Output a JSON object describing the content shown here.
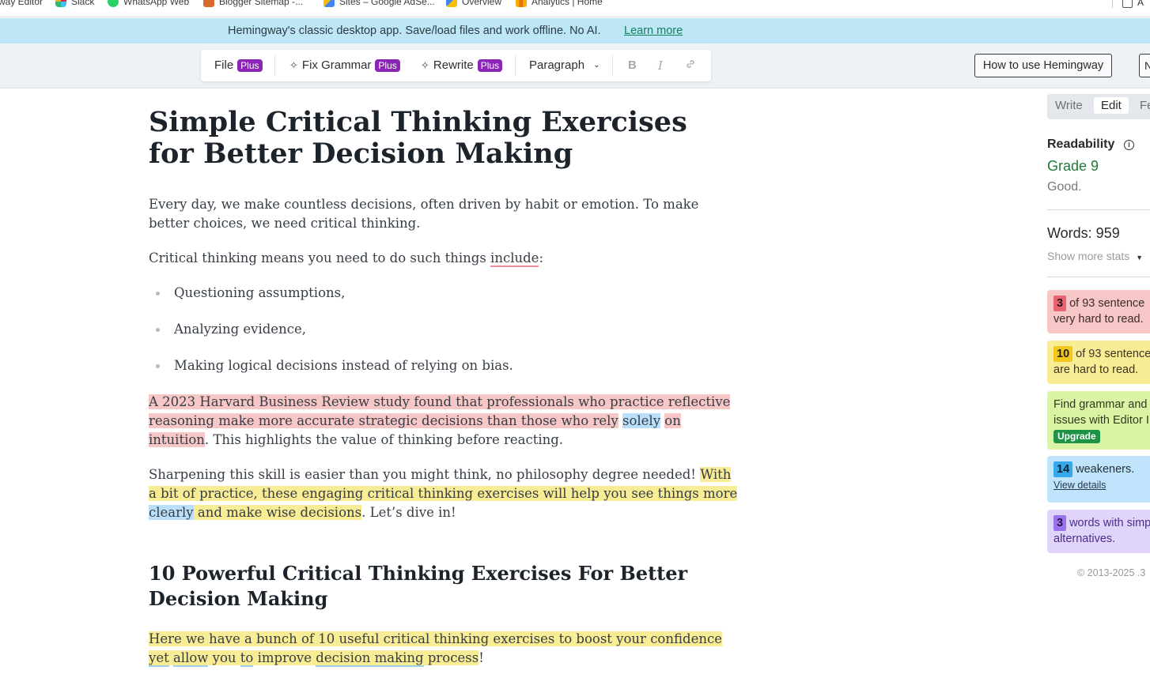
{
  "bookmarks": [
    {
      "label": "way Editor",
      "icon": "page-icon"
    },
    {
      "label": "Slack",
      "icon": "slack-icon"
    },
    {
      "label": "WhatsApp Web",
      "icon": "whatsapp-icon"
    },
    {
      "label": "Blogger Sitemap -...",
      "icon": "sitemap-icon"
    },
    {
      "label": "Sites – Google AdSe...",
      "icon": "adsense-icon"
    },
    {
      "label": "Overview",
      "icon": "overview-icon"
    },
    {
      "label": "Analytics | Home",
      "icon": "analytics-icon"
    }
  ],
  "bookmarks_right": "A",
  "banner": {
    "text": "Hemingway's classic desktop app. Save/load files and work offline. No AI.",
    "link": "Learn more"
  },
  "toolbar": {
    "file": "File",
    "fix_grammar": "Fix Grammar",
    "rewrite": "Rewrite",
    "plus": "Plus",
    "paragraph": "Paragraph",
    "bold": "B",
    "italic": "I",
    "how_to": "How to use Hemingway",
    "edge_button": "N"
  },
  "document": {
    "title": "Simple Critical Thinking Exercises for Better Decision Making",
    "p1": "Every day, we make countless decisions, often driven by habit or emotion. To make better choices, we need critical thinking.",
    "p2_a": "Critical thinking means you need to do such things ",
    "p2_include": "include",
    "p2_b": ":",
    "bullets": [
      "Questioning assumptions,",
      "Analyzing evidence,",
      "Making logical decisions instead of relying on bias."
    ],
    "p3_red_a": "A 2023 Harvard Business Review study found that professionals who practice reflective reasoning make more accurate strategic decisions than those who rely",
    "p3_space": " ",
    "p3_solely": "solely",
    "p3_red_b": "on intuition",
    "p3_rest": ". This highlights the value of thinking before reacting.",
    "p4_a": "Sharpening this skill is easier than you might think, no philosophy degree needed! ",
    "p4_yel_a": "With a bit of practice, these engaging critical thinking exercises will help you see things more",
    "p4_clearly": "clearly",
    "p4_yel_b": " and make wise decisions",
    "p4_rest": ". Let’s dive in!",
    "h2": "10 Powerful Critical Thinking Exercises For Better Decision Making",
    "p5_a": "Here we have a bunch of 10 useful critical thinking exercises to boost your confidence ",
    "p5_yet": "yet",
    "p5_sp1": " ",
    "p5_allow": "allow",
    "p5_you": " you ",
    "p5_to": "to",
    "p5_improve": " improve ",
    "p5_decision": "decision making",
    "p5_process": " process",
    "p5_end": "!"
  },
  "sidebar": {
    "tabs": [
      "Write",
      "Edit",
      "Fe"
    ],
    "readability_label": "Readability",
    "grade": "Grade 9",
    "grade_note": "Good.",
    "words": "Words: 959",
    "more_stats": "Show more stats",
    "cards": {
      "very_hard": {
        "count": "3",
        "text1": "of 93 sentence",
        "text2": "very hard to read."
      },
      "hard": {
        "count": "10",
        "text1": "of 93 sentence",
        "text2": "are hard to read."
      },
      "grammar": {
        "text1": "Find grammar and",
        "text2": "issues with Editor I",
        "button": "Upgrade"
      },
      "weakeners": {
        "count": "14",
        "text1": "weakeners.",
        "link": "View details"
      },
      "simpler": {
        "count": "3",
        "text1": "words with simp",
        "text2": "alternatives."
      }
    },
    "copyright": "© 2013-2025 .3"
  },
  "colors": {
    "banner_bg": "#bde6f7",
    "plus_badge": "#8a25b5",
    "hard_red": "#f7c6c6",
    "hard_yellow": "#f8ec94",
    "adverb_blue": "#b9dffb",
    "grade_green": "#1f7a3a"
  }
}
